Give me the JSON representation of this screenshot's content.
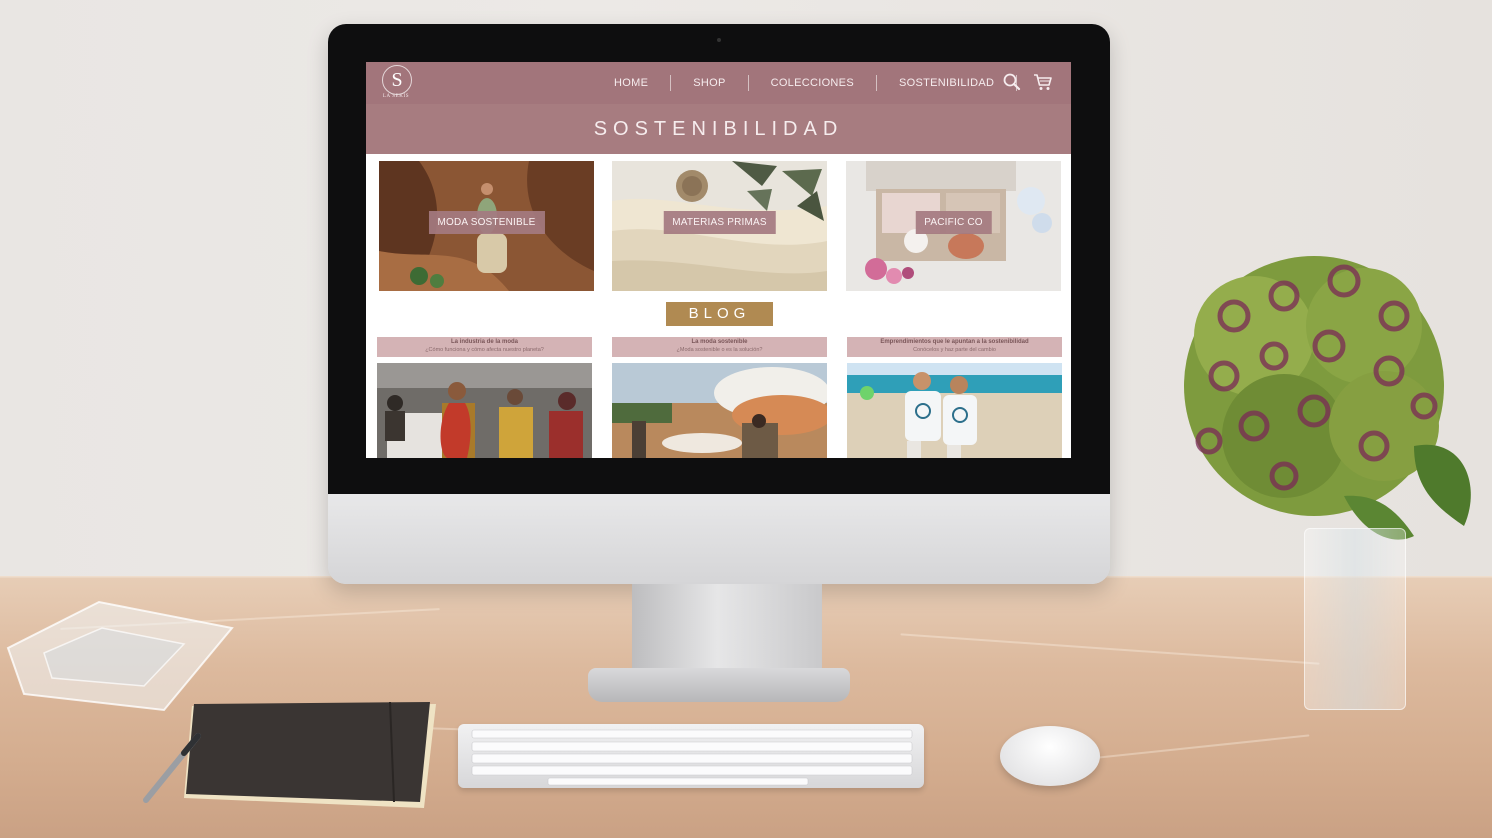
{
  "site": {
    "logo": {
      "letter": "S",
      "name": "LA SEKIS"
    },
    "nav": {
      "items": [
        {
          "label": "HOME"
        },
        {
          "label": "SHOP"
        },
        {
          "label": "COLECCIONES"
        },
        {
          "label": "SOSTENIBILIDAD"
        }
      ],
      "icons": [
        "search-icon",
        "cart-icon"
      ]
    },
    "page_title": "SOSTENIBILIDAD",
    "categories": [
      {
        "label": "MODA SOSTENIBLE"
      },
      {
        "label": "MATERIAS PRIMAS"
      },
      {
        "label": "PACIFIC CO"
      }
    ],
    "blog_label": "BLOG",
    "posts": [
      {
        "title": "La industria de la moda",
        "subtitle": "¿Cómo funciona y cómo afecta nuestro planeta?"
      },
      {
        "title": "La moda sostenible",
        "subtitle": "¿Moda sostenible o es la solución?"
      },
      {
        "title": "Emprendimientos que le apuntan a la sostenibilidad",
        "subtitle": "Conócelos y haz parte del cambio"
      }
    ]
  },
  "colors": {
    "nav_bg": "#a2757b",
    "title_band": "#a77c80",
    "blog_badge": "#b08a52",
    "post_header": "#d4b3b5"
  }
}
